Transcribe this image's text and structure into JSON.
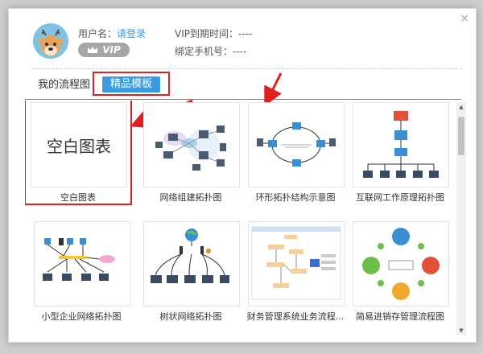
{
  "dialog": {
    "close_icon": "×"
  },
  "user": {
    "username_label": "用户名：",
    "login_link": "请登录",
    "vip_badge": "VIP",
    "vip_expiry": "VIP到期时间：----",
    "phone": "绑定手机号：----"
  },
  "tabs": [
    {
      "label": "我的流程图",
      "active": false
    },
    {
      "label": "精品模板",
      "active": true
    }
  ],
  "templates": [
    {
      "label": "空白图表",
      "thumb_text": "空白图表"
    },
    {
      "label": "网络组建拓扑图"
    },
    {
      "label": "环形拓扑结构示意图"
    },
    {
      "label": "互联网工作原理拓扑图"
    },
    {
      "label": "小型企业网络拓扑图"
    },
    {
      "label": "树状网络拓扑图"
    },
    {
      "label": "财务管理系统业务流程..."
    },
    {
      "label": "简易进销存管理流程图"
    }
  ],
  "colors": {
    "accent": "#3a9be0",
    "annotation": "#e02020"
  }
}
